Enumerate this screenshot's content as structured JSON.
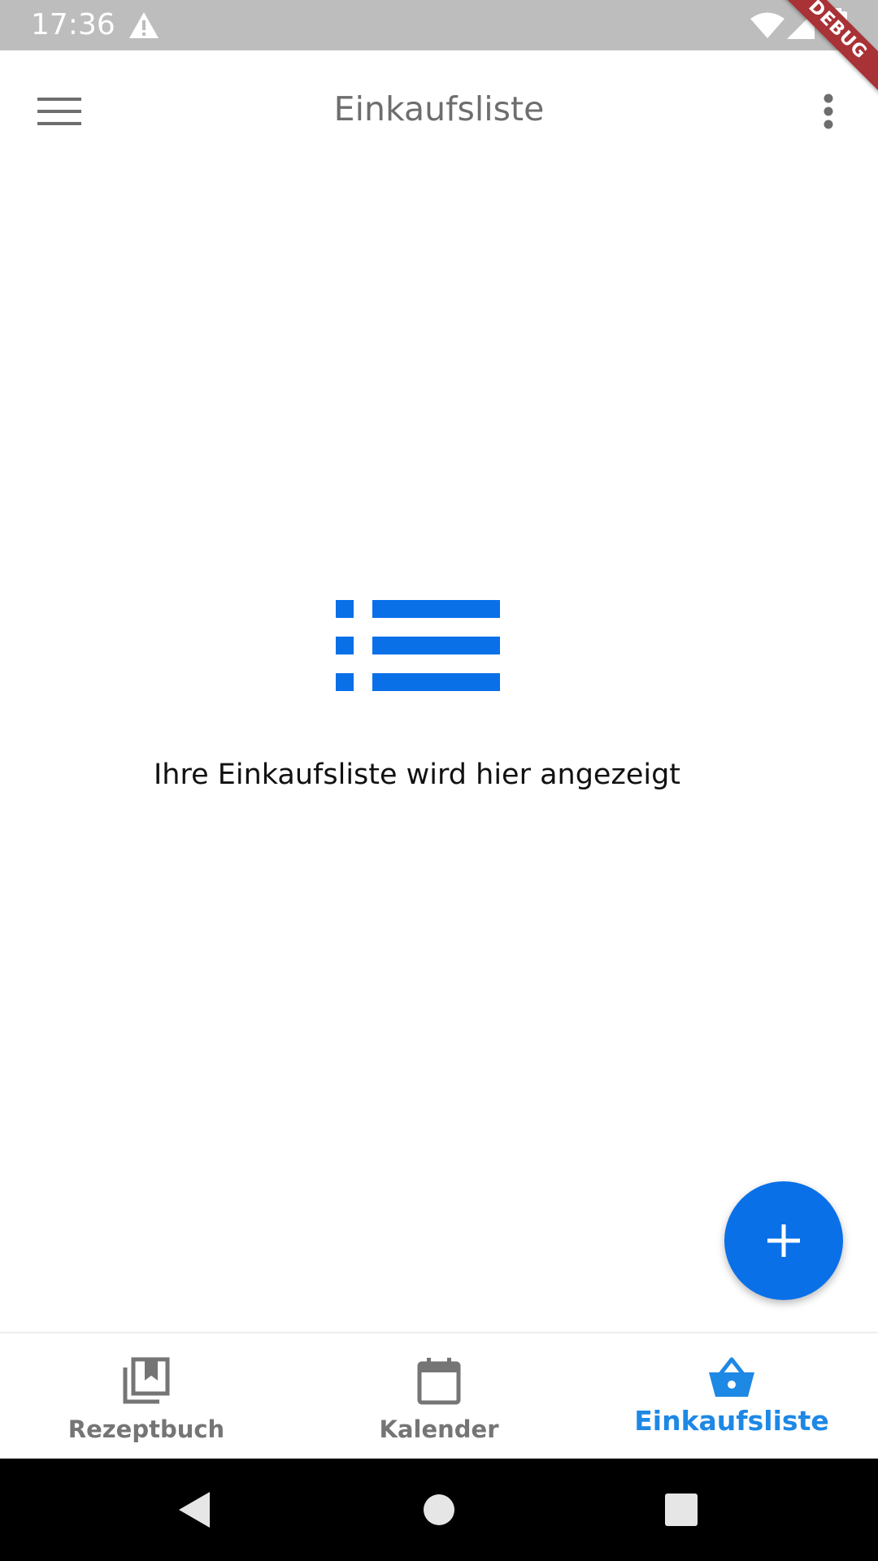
{
  "status_bar": {
    "time": "17:36",
    "icons": [
      "warning-icon",
      "wifi-icon",
      "signal-icon",
      "battery-icon"
    ]
  },
  "debug_banner": {
    "label": "DEBUG",
    "color": "#a83236"
  },
  "app_bar": {
    "title": "Einkaufsliste",
    "leading_icon": "menu-icon",
    "trailing_icon": "more-vert-icon"
  },
  "empty_state": {
    "icon": "list-icon",
    "message": "Ihre Einkaufsliste wird hier angezeigt"
  },
  "fab": {
    "icon": "plus-icon",
    "color": "#0a70e8"
  },
  "bottom_nav": {
    "active_color": "#1e88e5",
    "inactive_color": "#757575",
    "items": [
      {
        "label": "Rezeptbuch",
        "icon": "recipe-book-icon",
        "active": false
      },
      {
        "label": "Kalender",
        "icon": "calendar-icon",
        "active": false
      },
      {
        "label": "Einkaufsliste",
        "icon": "basket-icon",
        "active": true
      }
    ]
  },
  "system_nav": {
    "buttons": [
      "back-icon",
      "home-icon",
      "recents-icon"
    ]
  },
  "colors": {
    "accent": "#0a70e8",
    "status_bar": "#bdbdbd",
    "system_nav": "#000000"
  }
}
